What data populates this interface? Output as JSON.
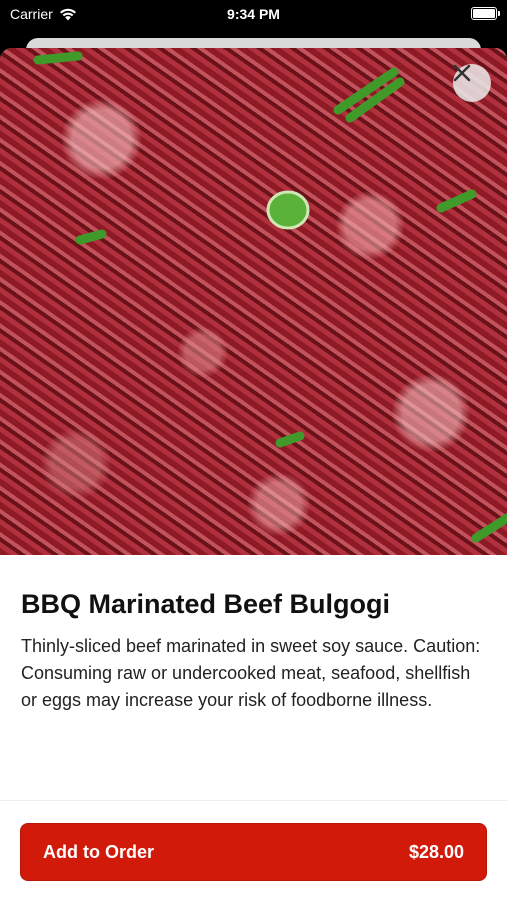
{
  "status_bar": {
    "carrier": "Carrier",
    "time": "9:34 PM"
  },
  "item": {
    "image_alt": "Marinated beef bulgogi with green onion",
    "title": "BBQ Marinated Beef Bulgogi",
    "description": "Thinly-sliced beef marinated in sweet soy sauce. Caution: Consuming raw or undercooked meat, seafood, shellfish or eggs may increase your risk of foodborne illness."
  },
  "actions": {
    "add_to_order_label": "Add to Order",
    "price": "$28.00"
  },
  "icons": {
    "close": "close-icon",
    "favorite": "heart-icon",
    "wifi": "wifi-icon",
    "battery": "battery-icon"
  },
  "colors": {
    "accent": "#d11a0a"
  }
}
